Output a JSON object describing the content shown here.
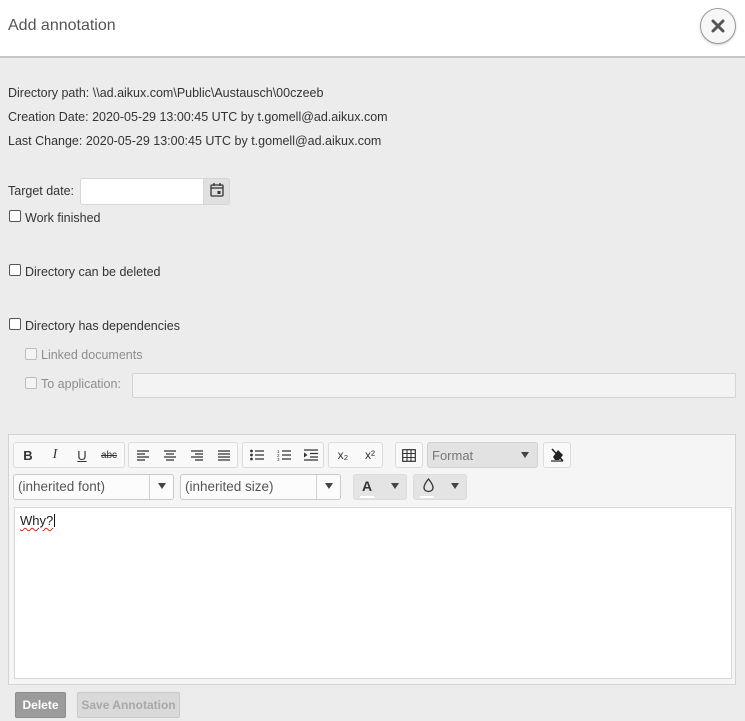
{
  "dialog": {
    "title": "Add annotation"
  },
  "info": {
    "directory_path": "Directory path: \\\\ad.aikux.com\\Public\\Austausch\\00czeeb",
    "creation_date": "Creation Date: 2020-05-29 13:00:45 UTC by t.gomell@ad.aikux.com",
    "last_change": "Last Change: 2020-05-29 13:00:45 UTC by t.gomell@ad.aikux.com"
  },
  "form": {
    "target_date_label": "Target date:",
    "target_date_value": "",
    "work_finished_label": "Work finished",
    "work_finished_checked": false,
    "can_be_deleted_label": "Directory can be deleted",
    "can_be_deleted_checked": false,
    "has_dependencies_label": "Directory has dependencies",
    "has_dependencies_checked": false,
    "linked_documents_label": "Linked documents",
    "to_application_label": "To application:",
    "to_application_value": ""
  },
  "editor": {
    "toolbar": {
      "bold": "B",
      "italic": "I",
      "underline": "U",
      "strikethrough": "abc",
      "format_label": "Format",
      "font_label": "(inherited font)",
      "size_label": "(inherited size)",
      "text_color_label": "A",
      "subscript": "x₂",
      "superscript": "x²"
    },
    "content_text": "Why?"
  },
  "buttons": {
    "delete_label": "Delete",
    "save_label": "Save Annotation"
  },
  "colors": {
    "dialog_background": "#ececec",
    "header_background": "#ffffff",
    "delete_button": "#9b9b9b",
    "save_button_disabled": "#d9d9d9"
  },
  "icons": [
    "close-icon",
    "calendar-icon",
    "align-left-icon",
    "align-center-icon",
    "align-right-icon",
    "align-justify-icon",
    "bullet-list-icon",
    "numbered-list-icon",
    "indent-icon",
    "table-icon",
    "clear-format-icon",
    "fill-color-icon"
  ]
}
